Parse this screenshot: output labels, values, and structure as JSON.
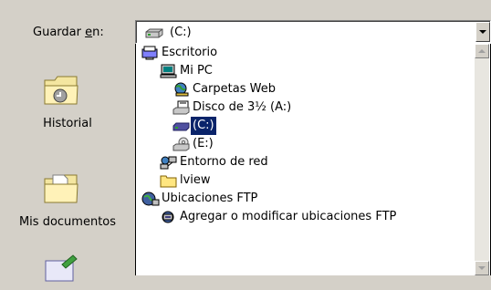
{
  "save_in": {
    "label_pre": "Guardar ",
    "label_access": "e",
    "label_post": "n:",
    "value": "(C:)"
  },
  "places": [
    {
      "label": "Historial",
      "icon": "history-folder-icon"
    },
    {
      "label": "Mis documentos",
      "icon": "my-documents-folder-icon"
    },
    {
      "label": "",
      "icon": "desktop-icon"
    }
  ],
  "dropdown": {
    "items": [
      {
        "label": "Escritorio",
        "icon": "desktop-icon",
        "indent": 0
      },
      {
        "label": "Mi PC",
        "icon": "my-computer-icon",
        "indent": 1
      },
      {
        "label": "Carpetas Web",
        "icon": "web-folders-icon",
        "indent": 2
      },
      {
        "label": "Disco de 3½ (A:)",
        "icon": "floppy-drive-icon",
        "indent": 2
      },
      {
        "label": "(C:)",
        "icon": "hard-drive-icon",
        "indent": 2,
        "selected": true
      },
      {
        "label": "(E:)",
        "icon": "cd-drive-icon",
        "indent": 2
      },
      {
        "label": "Entorno de red",
        "icon": "network-icon",
        "indent": 1
      },
      {
        "label": "lview",
        "icon": "folder-icon",
        "indent": 1
      },
      {
        "label": "Ubicaciones FTP",
        "icon": "ftp-locations-icon",
        "indent": 0
      },
      {
        "label": "Agregar o modificar ubicaciones FTP",
        "icon": "ftp-add-icon",
        "indent": 1
      }
    ]
  },
  "colors": {
    "dialog_bg": "#d4d0c8",
    "selection_bg": "#0a246a",
    "selection_fg": "#ffffff"
  }
}
